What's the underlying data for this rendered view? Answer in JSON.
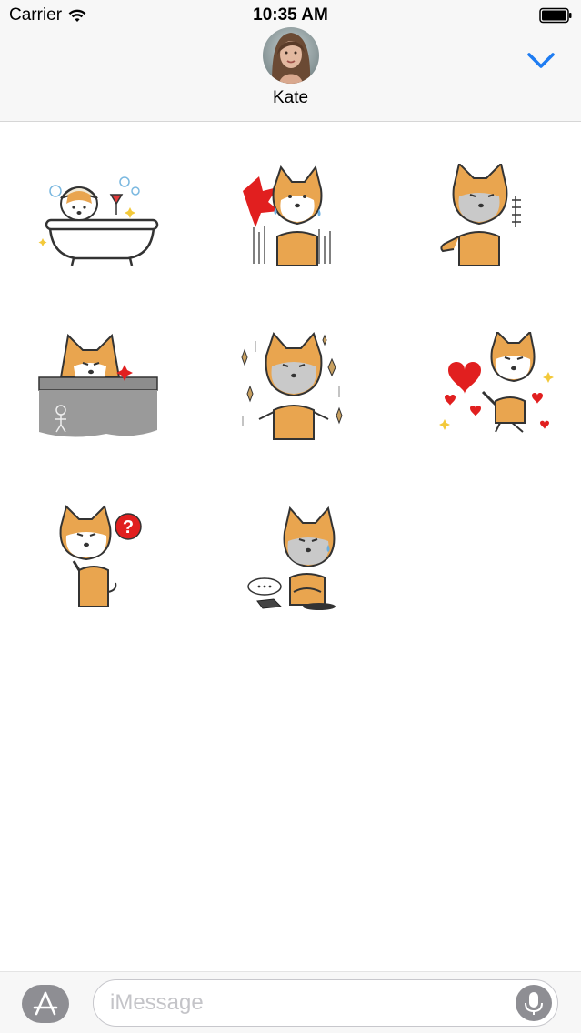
{
  "status_bar": {
    "carrier": "Carrier",
    "time": "10:35 AM"
  },
  "header": {
    "contact_name": "Kate",
    "collapse_icon": "chevron-down-icon",
    "accent_color": "#1e7cf2"
  },
  "stickers": [
    {
      "icon": "shiba-bathtub-sticker"
    },
    {
      "icon": "shiba-shocked-sticker"
    },
    {
      "icon": "shiba-pointing-sticker"
    },
    {
      "icon": "shiba-wall-peek-sticker"
    },
    {
      "icon": "shiba-shrug-sparkles-sticker"
    },
    {
      "icon": "shiba-hearts-sticker"
    },
    {
      "icon": "shiba-question-sticker"
    },
    {
      "icon": "shiba-phone-sad-sticker"
    }
  ],
  "composer": {
    "placeholder": "iMessage",
    "appstore_icon": "app-store-icon",
    "mic_icon": "microphone-icon"
  }
}
